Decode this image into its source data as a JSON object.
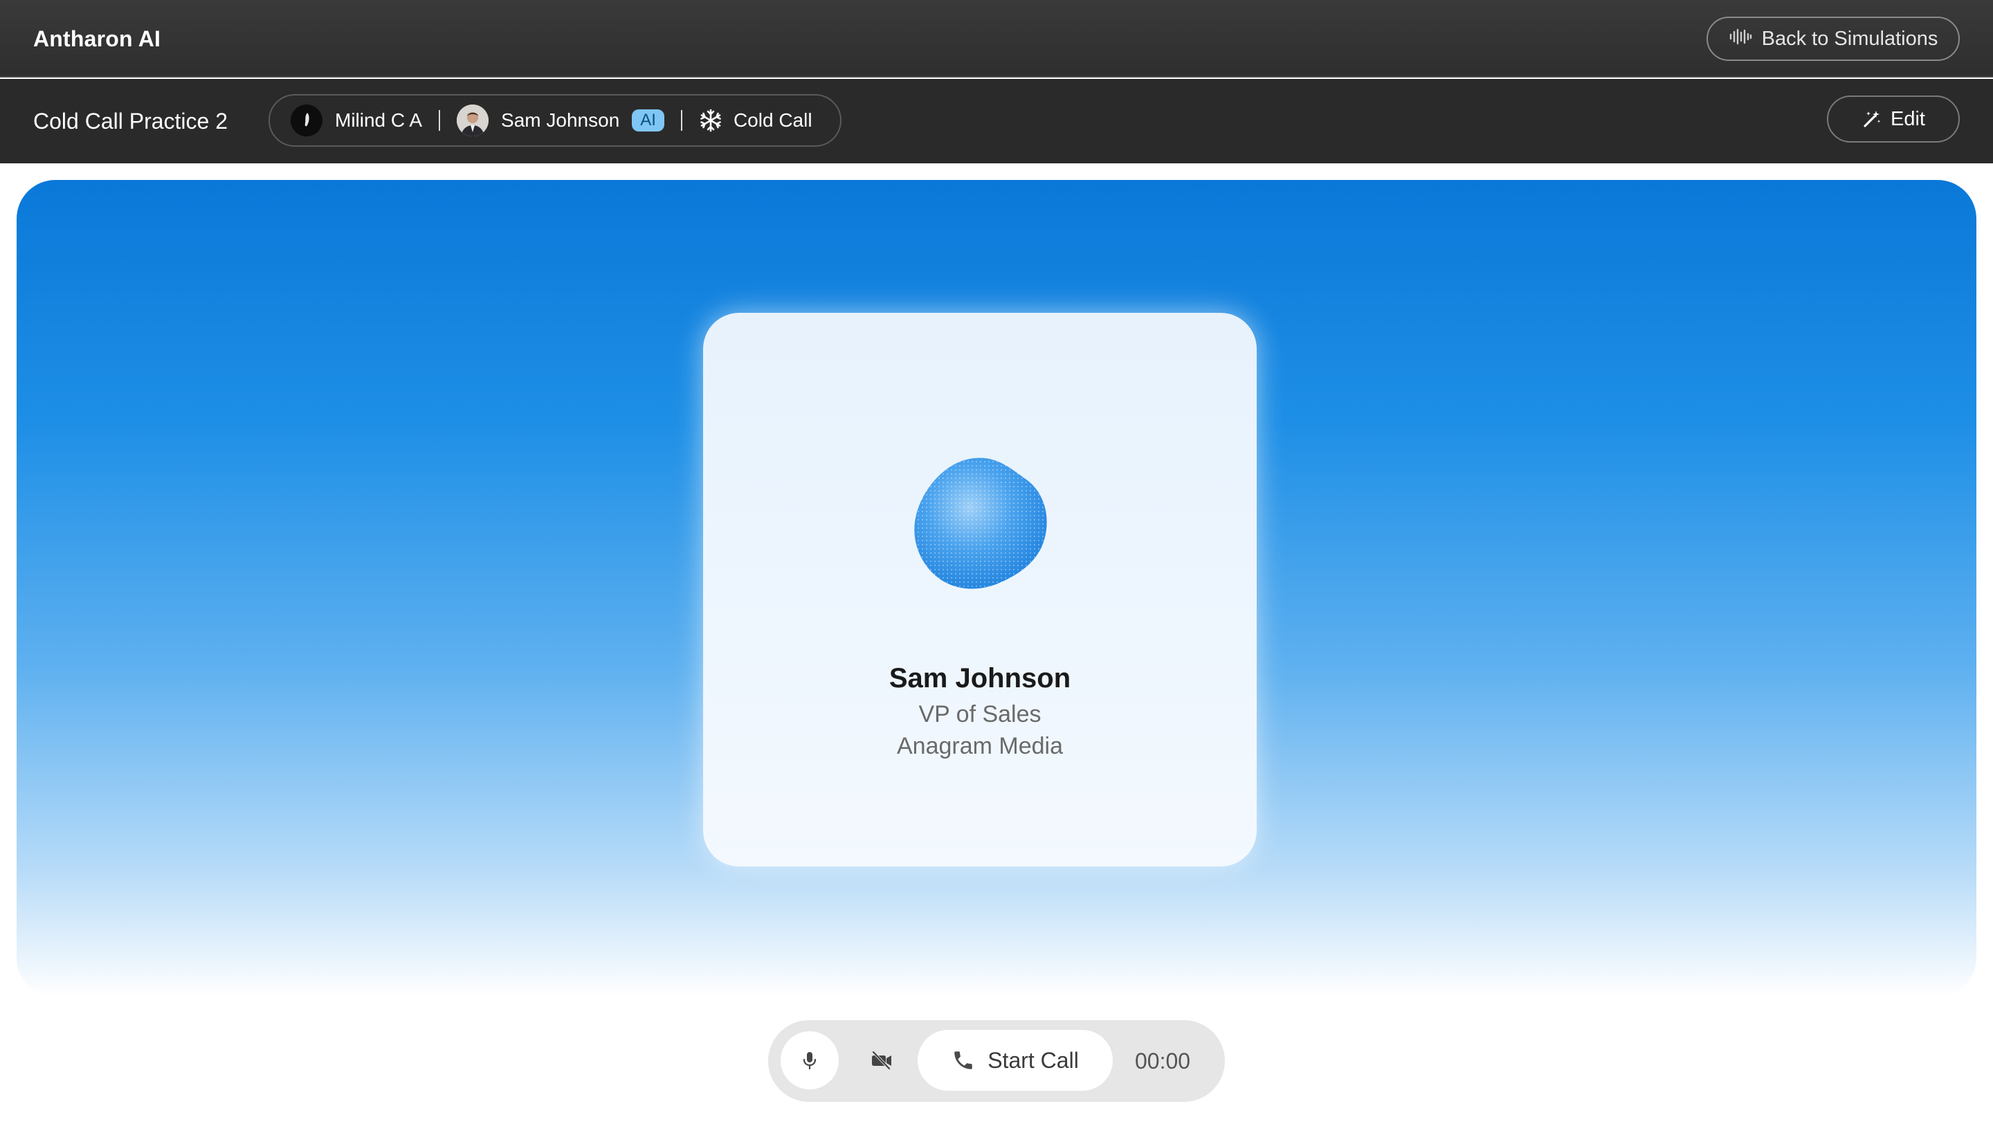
{
  "header": {
    "brand": "Antharon AI",
    "back_label": "Back to Simulations"
  },
  "simulation": {
    "title": "Cold Call Practice 2",
    "participants": {
      "user_name": "Milind C A",
      "ai_name": "Sam Johnson",
      "ai_badge": "AI",
      "scenario": "Cold Call"
    },
    "edit_label": "Edit"
  },
  "persona": {
    "name": "Sam Johnson",
    "role": "VP of Sales",
    "company": "Anagram Media"
  },
  "call": {
    "start_label": "Start Call",
    "timer": "00:00"
  },
  "colors": {
    "accent": "#0a78d8",
    "ai_badge": "#7fc6f5"
  }
}
